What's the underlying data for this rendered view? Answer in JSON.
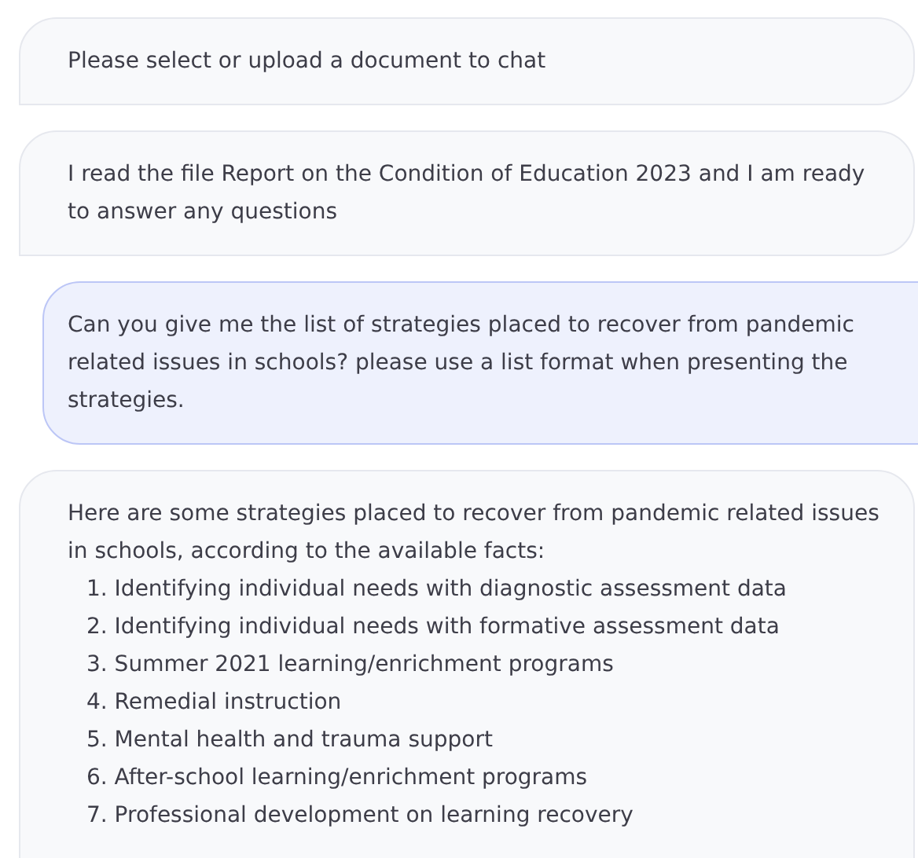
{
  "messages": [
    {
      "kind": "bot",
      "text": "Please select or upload a document to chat"
    },
    {
      "kind": "bot",
      "text": "I read the file Report on the Condition of Education 2023 and I am ready to answer any questions"
    },
    {
      "kind": "user",
      "text": "Can you give me the list of strategies placed to recover from pandemic related issues in schools? please use a list format when presenting the strategies."
    },
    {
      "kind": "bot",
      "text": "Here are some strategies placed to recover from pandemic related issues in schools, according to the available facts:",
      "list": [
        "1. Identifying individual needs with diagnostic assessment data",
        "2. Identifying individual needs with formative assessment data",
        "3. Summer 2021 learning/enrichment programs",
        "4. Remedial instruction",
        "5. Mental health and trauma support",
        "6. After-school learning/enrichment programs",
        "7. Professional development on learning recovery"
      ]
    }
  ]
}
